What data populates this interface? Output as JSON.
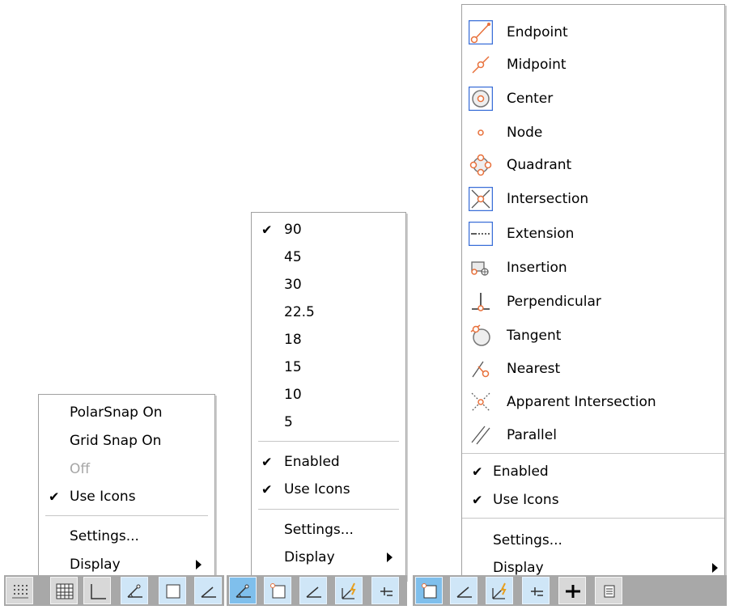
{
  "menu_snap": {
    "items": [
      {
        "label": "PolarSnap On",
        "checked": false,
        "disabled": false
      },
      {
        "label": "Grid Snap On",
        "checked": false,
        "disabled": false
      },
      {
        "label": "Off",
        "checked": false,
        "disabled": true
      },
      {
        "label": "Use Icons",
        "checked": true,
        "disabled": false
      }
    ],
    "settings_label": "Settings...",
    "display_label": "Display"
  },
  "menu_polar": {
    "angles": [
      "90",
      "45",
      "30",
      "22.5",
      "18",
      "15",
      "10",
      "5"
    ],
    "selected_angle": "90",
    "enabled_label": "Enabled",
    "use_icons_label": "Use Icons",
    "settings_label": "Settings...",
    "display_label": "Display"
  },
  "menu_osnap": {
    "items": [
      {
        "label": "Endpoint",
        "icon": "endpoint-icon",
        "selected": true
      },
      {
        "label": "Midpoint",
        "icon": "midpoint-icon",
        "selected": false
      },
      {
        "label": "Center",
        "icon": "center-icon",
        "selected": true
      },
      {
        "label": "Node",
        "icon": "node-icon",
        "selected": false
      },
      {
        "label": "Quadrant",
        "icon": "quadrant-icon",
        "selected": false
      },
      {
        "label": "Intersection",
        "icon": "intersection-icon",
        "selected": true
      },
      {
        "label": "Extension",
        "icon": "extension-icon",
        "selected": true
      },
      {
        "label": "Insertion",
        "icon": "insertion-icon",
        "selected": false
      },
      {
        "label": "Perpendicular",
        "icon": "perpendicular-icon",
        "selected": false
      },
      {
        "label": "Tangent",
        "icon": "tangent-icon",
        "selected": false
      },
      {
        "label": "Nearest",
        "icon": "nearest-icon",
        "selected": false
      },
      {
        "label": "Apparent Intersection",
        "icon": "apparent-intersection-icon",
        "selected": false
      },
      {
        "label": "Parallel",
        "icon": "parallel-icon",
        "selected": false
      }
    ],
    "enabled_label": "Enabled",
    "use_icons_label": "Use Icons",
    "settings_label": "Settings...",
    "display_label": "Display"
  },
  "colors": {
    "accent_orange": "#e8703a",
    "selection_border": "#3a6fd8",
    "statusbar_active": "#7fbfec",
    "statusbar_inactive": "#d8d8d8"
  }
}
